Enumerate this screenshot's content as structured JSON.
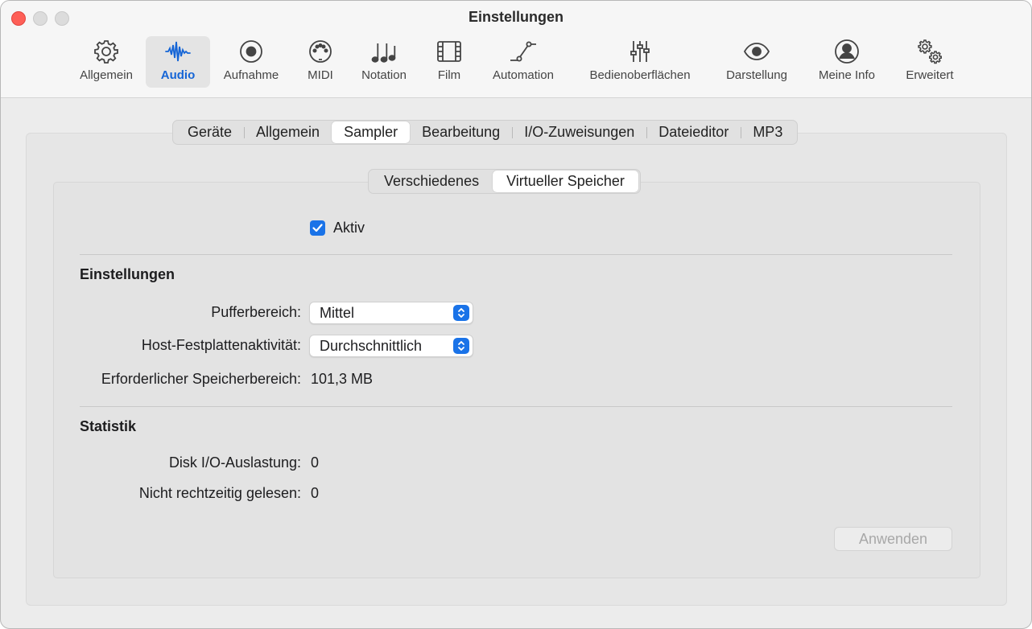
{
  "window": {
    "title": "Einstellungen"
  },
  "toolbar": {
    "items": [
      {
        "label": "Allgemein",
        "icon": "gear-icon"
      },
      {
        "label": "Audio",
        "icon": "waveform-icon",
        "active": true
      },
      {
        "label": "Aufnahme",
        "icon": "record-icon"
      },
      {
        "label": "MIDI",
        "icon": "midi-icon"
      },
      {
        "label": "Notation",
        "icon": "notes-icon"
      },
      {
        "label": "Film",
        "icon": "film-icon"
      },
      {
        "label": "Automation",
        "icon": "automation-icon"
      },
      {
        "label": "Bedienoberflächen",
        "icon": "sliders-icon"
      },
      {
        "label": "Darstellung",
        "icon": "eye-icon"
      },
      {
        "label": "Meine Info",
        "icon": "person-icon"
      },
      {
        "label": "Erweitert",
        "icon": "gears-icon"
      }
    ],
    "accent_color": "#1565d6"
  },
  "tabs": [
    "Geräte",
    "Allgemein",
    "Sampler",
    "Bearbeitung",
    "I/O-Zuweisungen",
    "Dateieditor",
    "MP3"
  ],
  "active_tab": "Sampler",
  "subtabs": [
    "Verschiedenes",
    "Virtueller Speicher"
  ],
  "active_subtab": "Virtueller Speicher",
  "active_checkbox": {
    "label": "Aktiv",
    "checked": true
  },
  "settings": {
    "title": "Einstellungen",
    "buffer_label": "Pufferbereich:",
    "buffer_value": "Mittel",
    "disk_activity_label": "Host-Festplattenaktivität:",
    "disk_activity_value": "Durchschnittlich",
    "memory_label": "Erforderlicher Speicherbereich:",
    "memory_value": "101,3 MB"
  },
  "statistics": {
    "title": "Statistik",
    "disk_io_label": "Disk I/O-Auslastung:",
    "disk_io_value": "0",
    "late_label": "Nicht rechtzeitig gelesen:",
    "late_value": "0"
  },
  "apply_button": {
    "label": "Anwenden",
    "enabled": false
  }
}
